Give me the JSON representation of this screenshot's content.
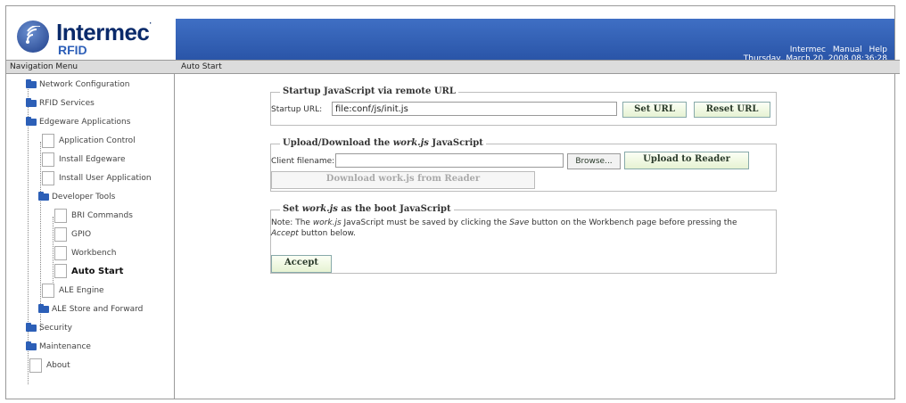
{
  "header": {
    "logo_word": "Intermec",
    "logo_registered": "·",
    "logo_sub": "RFID",
    "links": [
      "Intermec",
      "Manual",
      "Help"
    ],
    "date": "Thursday, March 20, 2008 08:36:28",
    "brand_color": "#2a55a8"
  },
  "nav": {
    "title": "Navigation Menu",
    "items": [
      {
        "label": "Network Configuration"
      },
      {
        "label": "RFID Services"
      },
      {
        "label": "Edgeware Applications"
      },
      {
        "label": "Application Control"
      },
      {
        "label": "Install Edgeware"
      },
      {
        "label": "Install User Application"
      },
      {
        "label": "Developer Tools"
      },
      {
        "label": "BRI Commands"
      },
      {
        "label": "GPIO"
      },
      {
        "label": "Workbench"
      },
      {
        "label": "Auto Start"
      },
      {
        "label": "ALE Engine"
      },
      {
        "label": "ALE Store and Forward"
      },
      {
        "label": "Security"
      },
      {
        "label": "Maintenance"
      },
      {
        "label": "About"
      }
    ]
  },
  "page_title": "Auto Start",
  "startup": {
    "legend": "Startup JavaScript via remote URL",
    "url_label": "Startup URL:",
    "url_value": "file:conf/js/init.js",
    "set_url": "Set URL",
    "reset_url": "Reset URL"
  },
  "upload": {
    "legend_pre": "Upload/Download the ",
    "legend_italic": "work.js",
    "legend_post": " JavaScript",
    "client_label": "Client filename:",
    "client_value": "",
    "browse": "Browse...",
    "upload_btn": "Upload to Reader",
    "download_btn": "Download work.js from Reader"
  },
  "boot": {
    "legend_pre": "Set ",
    "legend_italic": "work.js",
    "legend_post": " as the boot JavaScript",
    "note_1": "Note: The ",
    "note_2": "work.js",
    "note_3": " JavaScript must be saved by clicking the ",
    "note_4": "Save",
    "note_5": " button on the Workbench page before pressing the",
    "note_6": "Accept",
    "note_7": " button below.",
    "accept": "Accept"
  }
}
